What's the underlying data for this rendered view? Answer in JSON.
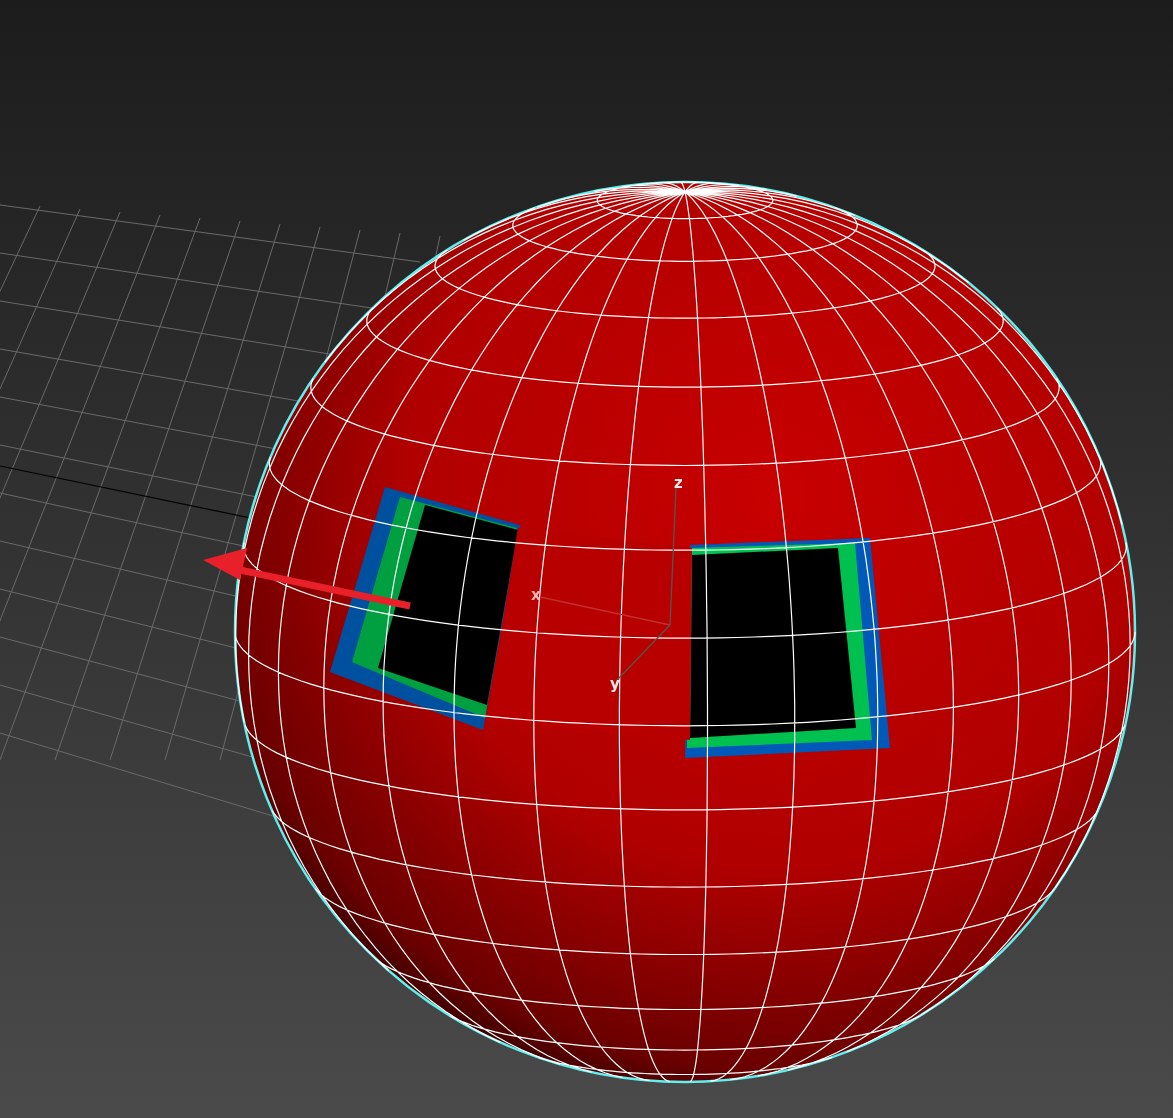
{
  "viewport": {
    "gizmo": {
      "axes": [
        {
          "label": "z"
        },
        {
          "label": "x"
        },
        {
          "label": "y"
        }
      ]
    }
  }
}
